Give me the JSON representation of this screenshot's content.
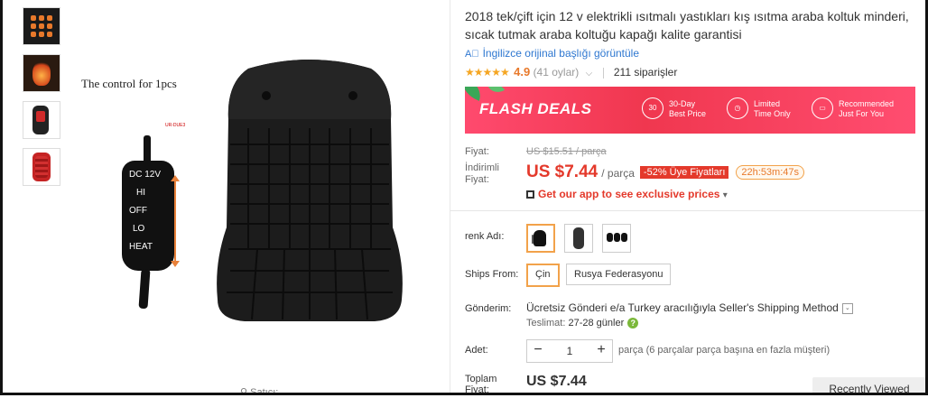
{
  "main_image": {
    "control_caption": "The control for 1pcs",
    "tag": "UR-DUE3",
    "remote_labels": [
      "DC 12V",
      "HI",
      "OFF",
      "LO",
      "HEAT"
    ]
  },
  "seller_link": "Satıcı:",
  "product": {
    "title": "2018 tek/çift için 12 v elektrikli ısıtmalı yastıkları kış ısıtma araba koltuk minderi, sıcak tutmak araba koltuğu kapağı kalite garantisi",
    "translate_link": "İngilizce orijinal başlığı görüntüle",
    "stars": "★★★★★",
    "rating": "4.9",
    "rating_count": "(41 oylar)",
    "orders": "211 siparişler"
  },
  "flash_banner": {
    "title": "FLASH DEALS",
    "features": [
      {
        "icon": "30",
        "line1": "30-Day",
        "line2": "Best Price"
      },
      {
        "icon": "◷",
        "line1": "Limited",
        "line2": "Time Only"
      },
      {
        "icon": "▭",
        "line1": "Recommended",
        "line2": "Just For You"
      }
    ],
    "colors": {
      "background": "#f0374f",
      "leaf": "#3aa757"
    }
  },
  "price": {
    "list_label": "Fiyat:",
    "list_value": "US $15.51 / parça",
    "discount_label_1": "İndirimli",
    "discount_label_2": "Fiyat:",
    "discount_value": "US $7.44",
    "unit": "/ parça",
    "discount_badge": "-52% Üye Fiyatları",
    "timer": "22h:53m:47s",
    "app_text": "Get our app to see exclusive prices",
    "app_chevron": "▾"
  },
  "color": {
    "label": "renk Adı:",
    "selected_index": 0,
    "options": [
      "swatch-1",
      "swatch-2",
      "swatch-3"
    ]
  },
  "ships_from": {
    "label": "Ships From:",
    "options": [
      "Çin",
      "Rusya Federasyonu"
    ],
    "selected": "Çin"
  },
  "shipping": {
    "label": "Gönderim:",
    "method_bold": "Ücretsiz Gönderi e/a",
    "method_rest": " Turkey aracılığıyla Seller's Shipping Method",
    "delivery_label": "Teslimat:",
    "delivery_value": "27-28 günler",
    "help": "?"
  },
  "quantity": {
    "label": "Adet:",
    "minus": "−",
    "value": "1",
    "plus": "+",
    "note": "parça (6 parçalar parça başına en fazla müşteri)"
  },
  "total": {
    "label_1": "Toplam",
    "label_2": "Fiyat:",
    "value": "US $7.44"
  },
  "recently_viewed": "Recently Viewed"
}
